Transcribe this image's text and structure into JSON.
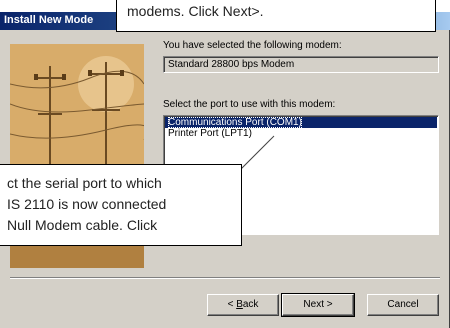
{
  "window": {
    "title": "Install New Mode"
  },
  "wizard": {
    "modem_label": "You have selected the following modem:",
    "modem_value": "Standard 28800 bps Modem",
    "port_label": "Select the port to use with this modem:",
    "ports": [
      {
        "label": "Communications Port (COM1)",
        "selected": true
      },
      {
        "label": "Printer Port (LPT1)",
        "selected": false
      }
    ]
  },
  "buttons": {
    "back_prefix": "< ",
    "back_underlined": "B",
    "back_rest": "ack",
    "next": "Next >",
    "cancel": "Cancel"
  },
  "callouts": {
    "top_text": "modems. Click Next>.",
    "left_lines": [
      "ct the serial port to which",
      "IS 2110 is now connected",
      "Null Modem cable. Click"
    ]
  },
  "colors": {
    "dialog_face": "#d4d0c8",
    "titlebar": "#0a246a",
    "selection": "#0a246a"
  }
}
